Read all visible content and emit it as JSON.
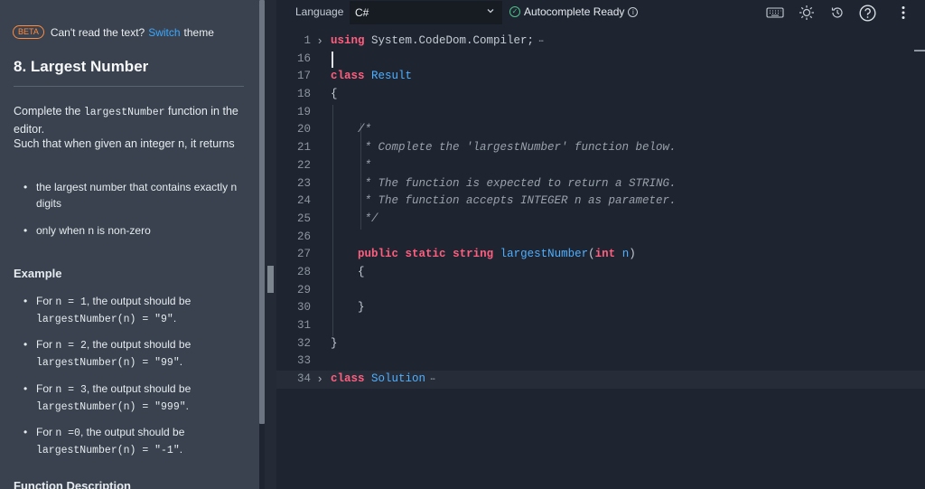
{
  "banner": {
    "beta": "BETA",
    "text": "Can't read the text?",
    "link": "Switch",
    "suffix": "theme"
  },
  "problem": {
    "title": "8. Largest Number",
    "desc_1a": "Complete the ",
    "desc_1b": "largestNumber",
    "desc_1c": " function in the editor.",
    "desc_2": "Such that when given an integer n, it returns",
    "bullets": [
      "the largest number that contains exactly n digits",
      "only when n is non-zero"
    ],
    "example_heading": "Example",
    "examples": [
      {
        "pre": "For ",
        "n": "n = 1",
        "mid": ", the output should be ",
        "code": "largestNumber(n) = \"9\"",
        "end": "."
      },
      {
        "pre": "For ",
        "n": "n = 2",
        "mid": ", the output should be ",
        "code": "largestNumber(n) = \"99\"",
        "end": "."
      },
      {
        "pre": "For ",
        "n": "n = 3",
        "mid": ", the output should be ",
        "code": "largestNumber(n) = \"999\"",
        "end": "."
      },
      {
        "pre": "For ",
        "n": "n =0",
        "mid": ", the output should be ",
        "code": "largestNumber(n) = \"-1\"",
        "end": "."
      }
    ],
    "next_heading": "Function Description"
  },
  "toolbar": {
    "language_label": "Language",
    "language_value": "C#",
    "autocomplete": "Autocomplete Ready",
    "icons": [
      "keyboard-icon",
      "sun-icon",
      "history-icon",
      "help-icon",
      "more-icon"
    ]
  },
  "editor": {
    "line_numbers": [
      "1",
      "16",
      "17",
      "18",
      "19",
      "20",
      "21",
      "22",
      "23",
      "24",
      "25",
      "26",
      "27",
      "28",
      "29",
      "30",
      "31",
      "32",
      "33",
      "34"
    ],
    "lines": [
      [
        "kw:using",
        "pl: System.CodeDom.Compiler;"
      ],
      [],
      [
        "kw:class",
        "pl: ",
        "ty:Result"
      ],
      [
        "pl:{"
      ],
      [],
      [
        "cm:    /*"
      ],
      [
        "cm:     * Complete the 'largestNumber' function below."
      ],
      [
        "cm:     *"
      ],
      [
        "cm:     * The function is expected to return a STRING."
      ],
      [
        "cm:     * The function accepts INTEGER n as parameter."
      ],
      [
        "cm:     */"
      ],
      [],
      [
        "pl:    ",
        "kw:public",
        "pl: ",
        "kw:static",
        "pl: ",
        "kw:string",
        "pl: ",
        "ty:largestNumber",
        "pl:(",
        "kw:int",
        "pl: ",
        "ty:n",
        "pl:)"
      ],
      [
        "pl:    {"
      ],
      [],
      [
        "pl:    }"
      ],
      [],
      [
        "pl:}"
      ],
      [],
      [
        "kw:class",
        "pl: ",
        "ty:Solution"
      ]
    ],
    "folded_lines": [
      "1",
      "34"
    ]
  }
}
